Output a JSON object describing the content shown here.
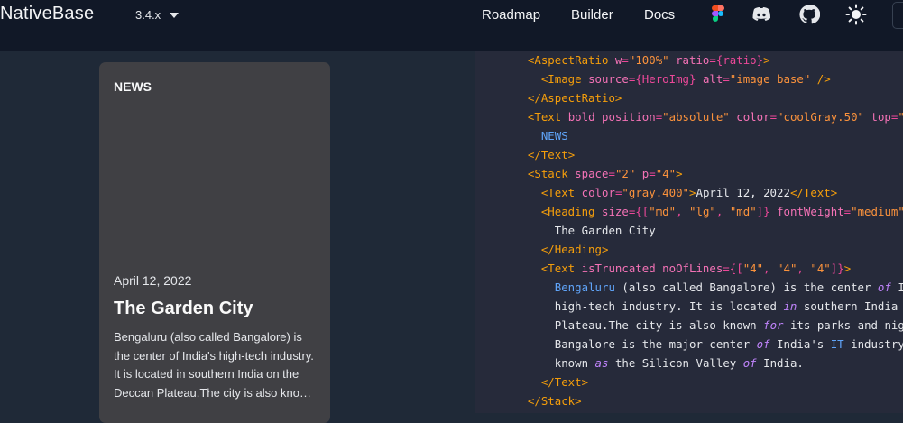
{
  "header": {
    "brand": "NativeBase",
    "version": "3.4.x",
    "nav": [
      "Roadmap",
      "Builder",
      "Docs"
    ],
    "icons": [
      "figma-icon",
      "discord-icon",
      "github-icon",
      "sun-icon"
    ]
  },
  "card": {
    "tag": "NEWS",
    "date": "April 12, 2022",
    "heading": "The Garden City",
    "body": "Bengaluru (also called Bangalore) is the center of India's high-tech industry. It is located in southern India on the Deccan Plateau.The city is also known for its parks and nightlife."
  },
  "code": {
    "lines": [
      "  <AspectRatio w=\"100%\" ratio={ratio}>",
      "    <Image source={HeroImg} alt=\"image base\" />",
      "  </AspectRatio>",
      "  <Text bold position=\"absolute\" color=\"coolGray.50\" top=\"",
      "    NEWS",
      "  </Text>",
      "  <Stack space=\"2\" p=\"4\">",
      "    <Text color=\"gray.400\">April 12, 2022</Text>",
      "    <Heading size={[\"md\", \"lg\", \"md\"]} fontWeight=\"medium\"",
      "      The Garden City",
      "    </Heading>",
      "    <Text isTruncated noOfLines={[\"4\", \"4\", \"4\"]}>",
      "      Bengaluru (also called Bangalore) is the center of I",
      "      high-tech industry. It is located in southern India",
      "      Plateau.The city is also known for its parks and nig",
      "      Bangalore is the major center of India's IT industry",
      "      known as the Silicon Valley of India.",
      "    </Text>",
      "  </Stack>"
    ]
  },
  "colors": {
    "header_bg": "#111827",
    "page_bg": "#1f2937",
    "card_bg": "#404044",
    "code_bg": "#262a3a"
  }
}
